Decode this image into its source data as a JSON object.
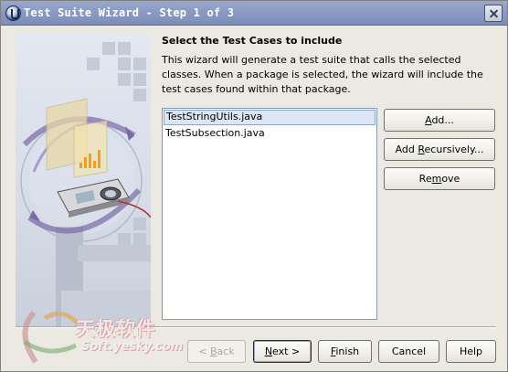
{
  "window": {
    "title": "Test Suite Wizard - Step 1 of 3",
    "titlebar_color": "#8a9ac2",
    "app_icon": "app-logo-icon",
    "close_icon": "close-icon"
  },
  "content": {
    "heading": "Select the Test Cases to include",
    "description": "This wizard will generate a test suite that calls the selected classes.  When a package is selected, the wizard will include the test cases found within that package."
  },
  "files": [
    {
      "name": "TestStringUtils.java",
      "selected": true
    },
    {
      "name": "TestSubsection.java",
      "selected": false
    }
  ],
  "side_buttons": {
    "add": {
      "pre": "",
      "mnemonic": "A",
      "post": "dd..."
    },
    "add_recursively": {
      "pre": "Add ",
      "mnemonic": "R",
      "post": "ecursively..."
    },
    "remove": {
      "pre": "Re",
      "mnemonic": "m",
      "post": "ove"
    }
  },
  "nav_buttons": {
    "back": {
      "pre": "< ",
      "mnemonic": "B",
      "post": "ack",
      "enabled": false
    },
    "next": {
      "pre": "",
      "mnemonic": "N",
      "post": "ext >",
      "enabled": true,
      "default": true
    },
    "finish": {
      "pre": "",
      "mnemonic": "F",
      "post": "inish",
      "enabled": true
    },
    "cancel": {
      "label": "Cancel",
      "enabled": true
    },
    "help": {
      "label": "Help",
      "enabled": true
    }
  },
  "watermark": {
    "chinese": "天极软件",
    "url": "Soft.yesky.com"
  }
}
